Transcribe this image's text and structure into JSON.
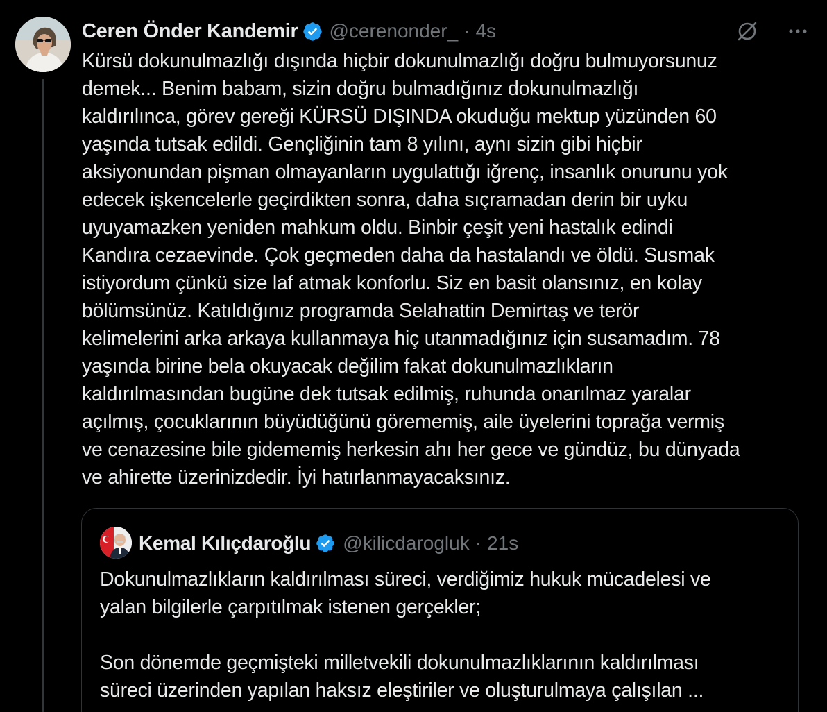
{
  "tweet": {
    "author": {
      "display_name": "Ceren Önder Kandemir",
      "handle": "@cerenonder_",
      "separator": "·",
      "time": "4s",
      "verified": true,
      "avatar_icon": "profile-photo-avatar"
    },
    "actions": {
      "grok_icon": "grok-icon",
      "more_icon": "more-icon"
    },
    "body_lines": [
      "Kürsü dokunulmazlığı dışında hiçbir dokunulmazlığı doğru bulmuyorsunuz",
      "demek... Benim babam, sizin doğru bulmadığınız dokunulmazlığı",
      "kaldırılınca, görev gereği KÜRSÜ DIŞINDA okuduğu mektup yüzünden 60",
      "yaşında tutsak edildi. Gençliğinin tam 8 yılını, aynı sizin gibi hiçbir",
      "aksiyonundan pişman olmayanların uygulattığı iğrenç, insanlık onurunu yok",
      "edecek işkencelerle geçirdikten sonra, daha sıçramadan derin bir uyku",
      "uyuyamazken yeniden mahkum oldu. Binbir çeşit yeni hastalık edindi",
      "Kandıra cezaevinde. Çok geçmeden daha da hastalandı ve öldü. Susmak",
      "istiyordum çünkü size laf atmak konforlu. Siz en basit olansınız, en kolay",
      "bölümsünüz. Katıldığınız programda Selahattin Demirtaş ve terör",
      "kelimelerini arka arkaya kullanmaya hiç utanmadığınız için susamadım. 78",
      "yaşında birine bela okuyacak değilim fakat dokunulmazlıkların",
      "kaldırılmasından bugüne dek tutsak edilmiş, ruhunda onarılmaz yaralar",
      "açılmış, çocuklarının büyüdüğünü görememiş, aile üyelerini toprağa vermiş",
      "ve cenazesine bile gidememiş herkesin ahı her gece ve gündüz, bu dünyada",
      "ve ahirette üzerinizdedir. İyi hatırlanmayacaksınız."
    ],
    "quote": {
      "author": {
        "display_name": "Kemal Kılıçdaroğlu",
        "handle": "@kilicdarogluk",
        "separator": "·",
        "time": "21s",
        "verified": true,
        "avatar_icon": "profile-photo-avatar"
      },
      "text_lines": [
        "Dokunulmazlıkların kaldırılması süreci, verdiğimiz hukuk mücadelesi ve",
        "yalan bilgilerle çarpıtılmak istenen gerçekler;",
        "",
        "Son dönemde geçmişteki milletvekili dokunulmazlıklarının kaldırılması",
        "süreci üzerinden yapılan haksız eleştiriler ve oluşturulmaya çalışılan ..."
      ]
    }
  },
  "colors": {
    "background": "#000000",
    "text_primary": "#e7e9ea",
    "text_secondary": "#71767b",
    "verified_blue": "#1d9bf0",
    "border": "#2f3336"
  }
}
